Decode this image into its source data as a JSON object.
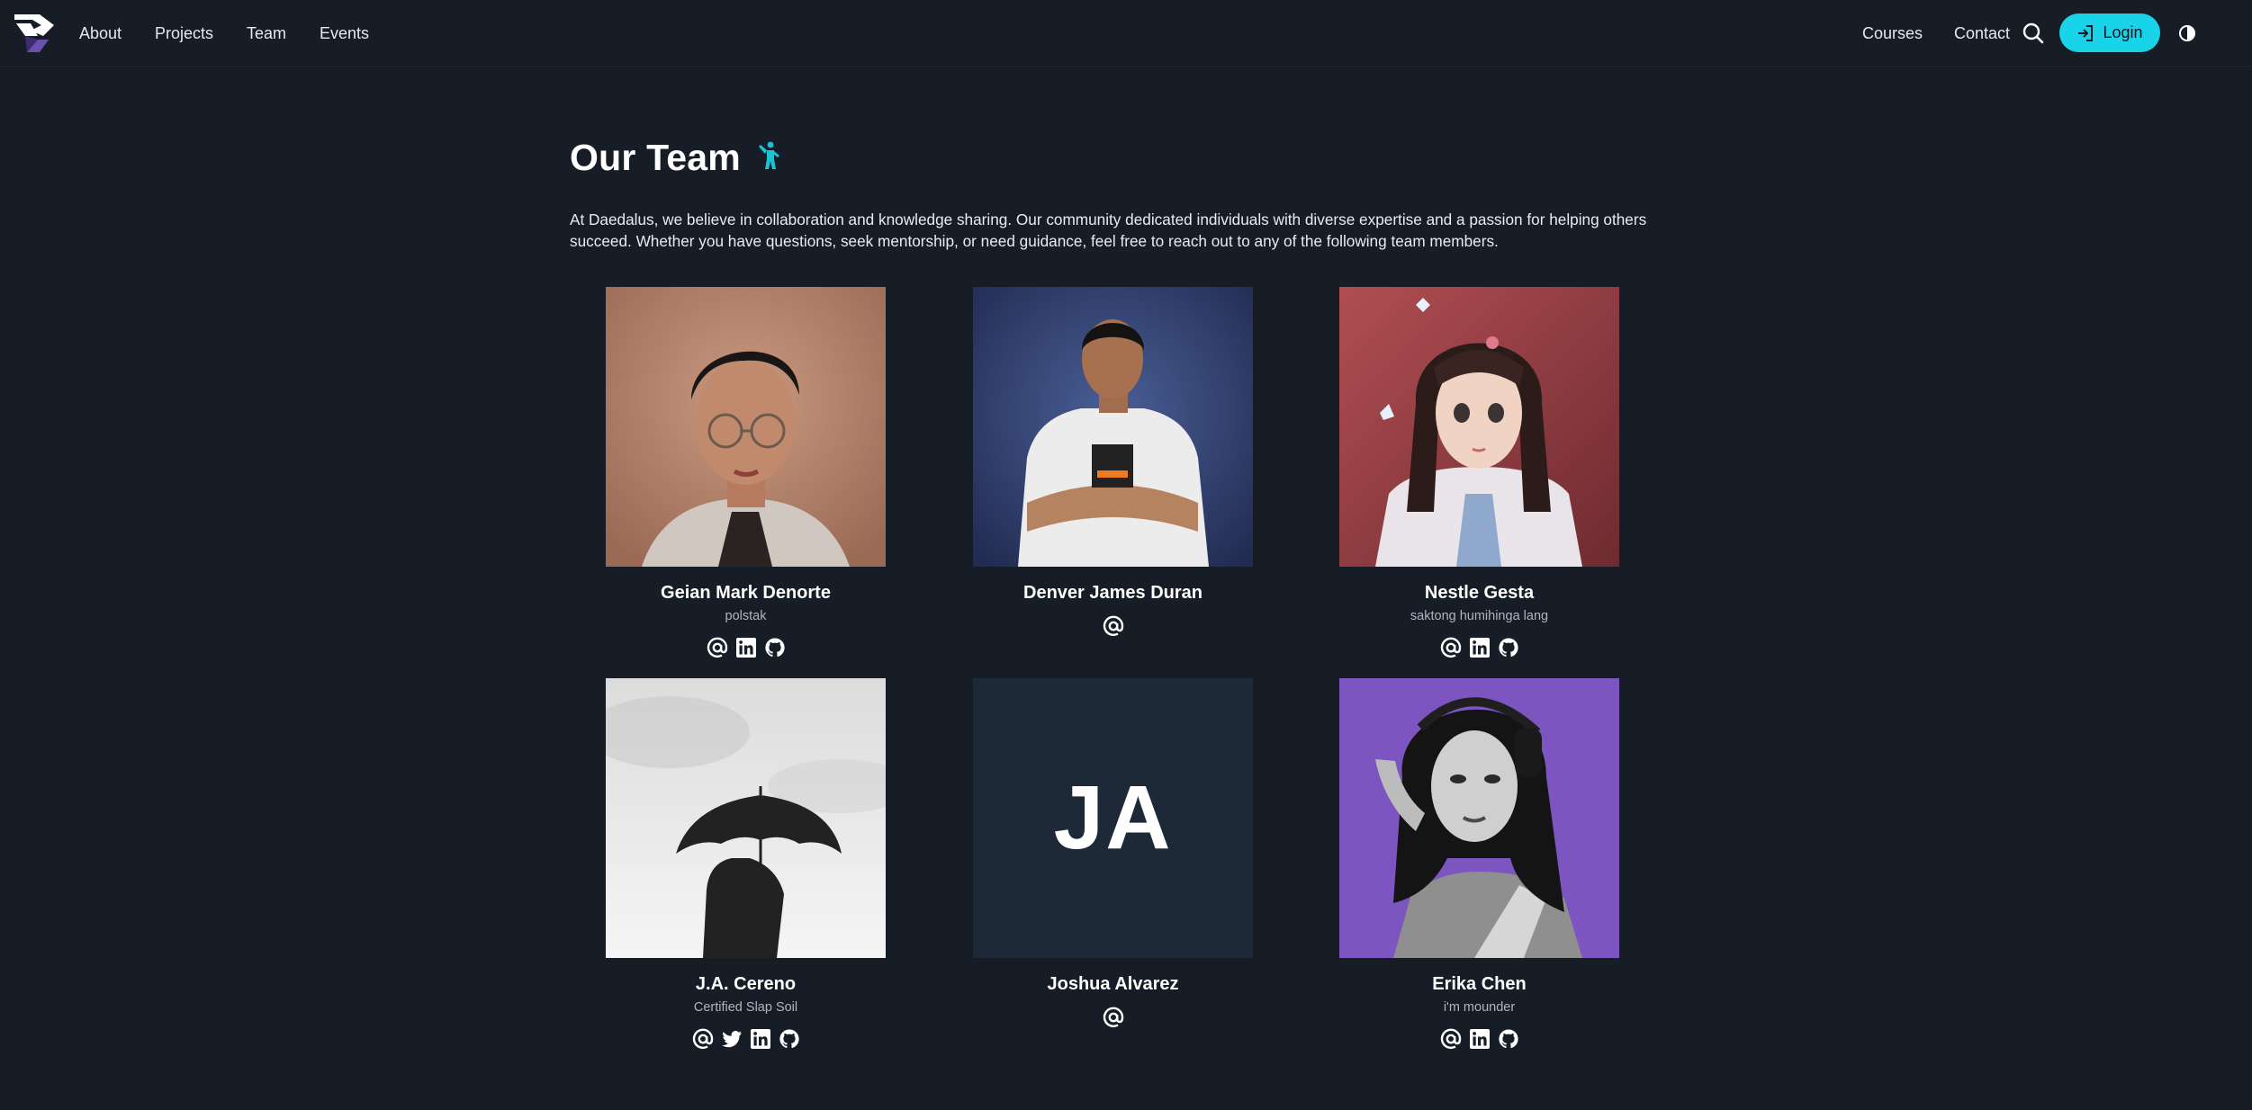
{
  "nav": {
    "logo_name": "daedalus-logo",
    "links": [
      "About",
      "Projects",
      "Team",
      "Events"
    ],
    "right_links": [
      "Courses",
      "Contact"
    ],
    "login_label": "Login",
    "search_icon": "search-icon",
    "theme_icon": "half-moon-icon"
  },
  "page": {
    "title": "Our Team",
    "title_icon": "person-waving-icon",
    "intro": "At Daedalus, we believe in collaboration and knowledge sharing. Our community dedicated individuals with diverse expertise and a passion for helping others succeed. Whether you have questions, seek mentorship, or need guidance, feel free to reach out to any of the following team members."
  },
  "members": [
    {
      "name": "Geian Mark Denorte",
      "role": "polstak",
      "socials": [
        "email",
        "linkedin",
        "github"
      ]
    },
    {
      "name": "Denver James Duran",
      "role": "",
      "socials": [
        "email"
      ]
    },
    {
      "name": "Nestle Gesta",
      "role": "saktong humihinga lang",
      "socials": [
        "email",
        "linkedin",
        "github"
      ]
    },
    {
      "name": "J.A. Cereno",
      "role": "Certified Slap Soil",
      "socials": [
        "email",
        "twitter",
        "linkedin",
        "github"
      ]
    },
    {
      "name": "Joshua Alvarez",
      "role": "",
      "initials": "JA",
      "socials": [
        "email"
      ]
    },
    {
      "name": "Erika Chen",
      "role": "i'm mounder",
      "socials": [
        "email",
        "linkedin",
        "github"
      ]
    }
  ],
  "colors": {
    "background": "#171d26",
    "accent": "#19d3e8",
    "text": "#e8ecf1",
    "muted": "#aeb6c1",
    "placeholder": "#1e2937"
  }
}
